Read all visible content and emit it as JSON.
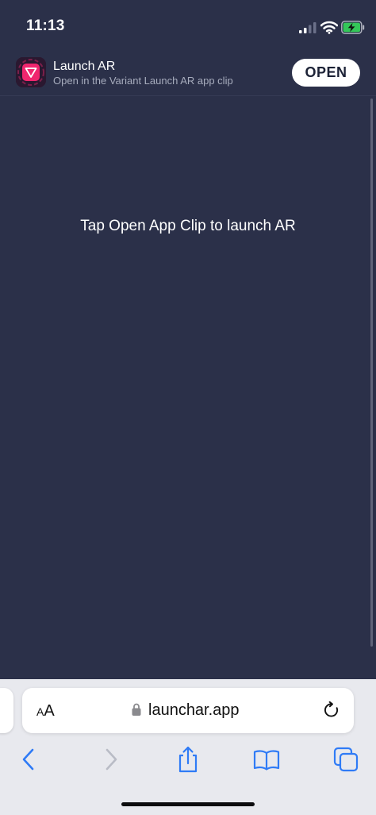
{
  "status": {
    "time": "11:13"
  },
  "banner": {
    "app_name": "Launch AR",
    "subtitle": "Open in the Variant Launch AR app clip",
    "open_label": "OPEN"
  },
  "main": {
    "message": "Tap Open App Clip to launch AR"
  },
  "address_bar": {
    "text_size_big": "A",
    "text_size_small": "A",
    "url": "launchar.app"
  },
  "colors": {
    "page_background": "#2b3049",
    "browser_chrome": "#e8e9ee",
    "toolbar_accent": "#2f7bf6",
    "app_icon_accent": "#f0266e"
  }
}
